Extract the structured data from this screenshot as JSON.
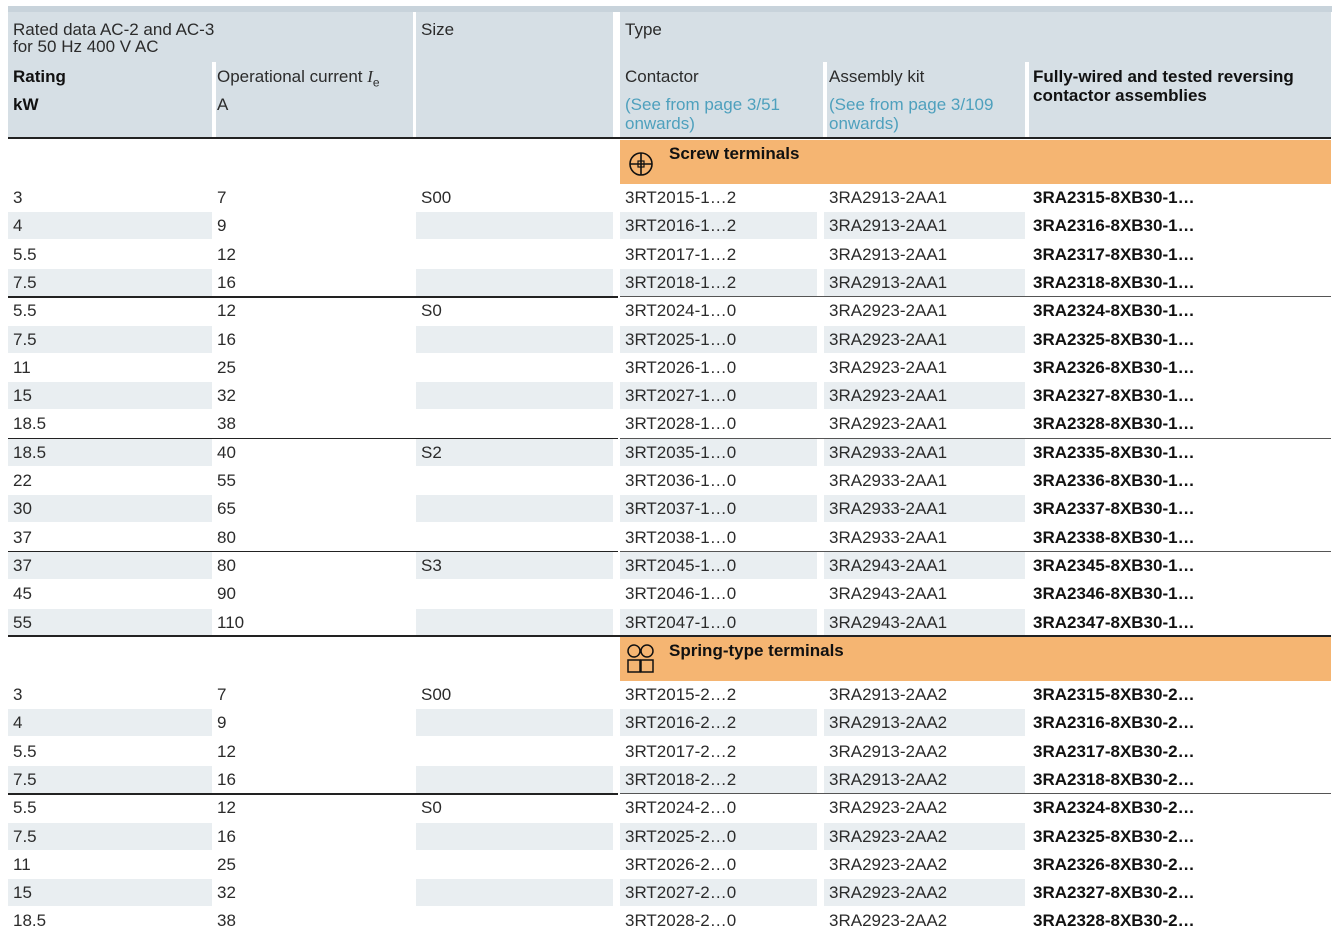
{
  "header": {
    "rated_data_line1": "Rated data AC-2 and AC-3",
    "rated_data_line2": "for 50 Hz 400 V AC",
    "size": "Size",
    "type": "Type",
    "rating": "Rating",
    "rating_unit": "kW",
    "operational_current": "Operational current ",
    "operational_current_symbol": "I",
    "operational_current_sub": "e",
    "operational_current_unit": "A",
    "contactor": "Contactor",
    "contactor_ref_line1": "(See from page 3/51",
    "contactor_ref_line2": "onwards)",
    "assembly_kit": "Assembly kit",
    "assembly_ref_line1": "(See from page 3/109",
    "assembly_ref_line2": "onwards)",
    "assemblies_line1": "Fully-wired and tested reversing",
    "assemblies_line2": "contactor assemblies"
  },
  "sections": [
    {
      "label": "Screw terminals",
      "icon": "screw-terminal-icon",
      "rows": [
        [
          "3",
          "7",
          "S00",
          "3RT2015-1…2",
          "3RA2913-2AA1",
          "3RA2315-8XB30-1…"
        ],
        [
          "4",
          "9",
          "",
          "3RT2016-1…2",
          "3RA2913-2AA1",
          "3RA2316-8XB30-1…"
        ],
        [
          "5.5",
          "12",
          "",
          "3RT2017-1…2",
          "3RA2913-2AA1",
          "3RA2317-8XB30-1…"
        ],
        [
          "7.5",
          "16",
          "",
          "3RT2018-1…2",
          "3RA2913-2AA1",
          "3RA2318-8XB30-1…"
        ],
        [
          "5.5",
          "12",
          "S0",
          "3RT2024-1…0",
          "3RA2923-2AA1",
          "3RA2324-8XB30-1…"
        ],
        [
          "7.5",
          "16",
          "",
          "3RT2025-1…0",
          "3RA2923-2AA1",
          "3RA2325-8XB30-1…"
        ],
        [
          "11",
          "25",
          "",
          "3RT2026-1…0",
          "3RA2923-2AA1",
          "3RA2326-8XB30-1…"
        ],
        [
          "15",
          "32",
          "",
          "3RT2027-1…0",
          "3RA2923-2AA1",
          "3RA2327-8XB30-1…"
        ],
        [
          "18.5",
          "38",
          "",
          "3RT2028-1…0",
          "3RA2923-2AA1",
          "3RA2328-8XB30-1…"
        ],
        [
          "18.5",
          "40",
          "S2",
          "3RT2035-1…0",
          "3RA2933-2AA1",
          "3RA2335-8XB30-1…"
        ],
        [
          "22",
          "55",
          "",
          "3RT2036-1…0",
          "3RA2933-2AA1",
          "3RA2336-8XB30-1…"
        ],
        [
          "30",
          "65",
          "",
          "3RT2037-1…0",
          "3RA2933-2AA1",
          "3RA2337-8XB30-1…"
        ],
        [
          "37",
          "80",
          "",
          "3RT2038-1…0",
          "3RA2933-2AA1",
          "3RA2338-8XB30-1…"
        ],
        [
          "37",
          "80",
          "S3",
          "3RT2045-1…0",
          "3RA2943-2AA1",
          "3RA2345-8XB30-1…"
        ],
        [
          "45",
          "90",
          "",
          "3RT2046-1…0",
          "3RA2943-2AA1",
          "3RA2346-8XB30-1…"
        ],
        [
          "55",
          "110",
          "",
          "3RT2047-1…0",
          "3RA2943-2AA1",
          "3RA2347-8XB30-1…"
        ]
      ]
    },
    {
      "label": "Spring-type terminals",
      "icon": "spring-terminal-icon",
      "rows": [
        [
          "3",
          "7",
          "S00",
          "3RT2015-2…2",
          "3RA2913-2AA2",
          "3RA2315-8XB30-2…"
        ],
        [
          "4",
          "9",
          "",
          "3RT2016-2…2",
          "3RA2913-2AA2",
          "3RA2316-8XB30-2…"
        ],
        [
          "5.5",
          "12",
          "",
          "3RT2017-2…2",
          "3RA2913-2AA2",
          "3RA2317-8XB30-2…"
        ],
        [
          "7.5",
          "16",
          "",
          "3RT2018-2…2",
          "3RA2913-2AA2",
          "3RA2318-8XB30-2…"
        ],
        [
          "5.5",
          "12",
          "S0",
          "3RT2024-2…0",
          "3RA2923-2AA2",
          "3RA2324-8XB30-2…"
        ],
        [
          "7.5",
          "16",
          "",
          "3RT2025-2…0",
          "3RA2923-2AA2",
          "3RA2325-8XB30-2…"
        ],
        [
          "11",
          "25",
          "",
          "3RT2026-2…0",
          "3RA2923-2AA2",
          "3RA2326-8XB30-2…"
        ],
        [
          "15",
          "32",
          "",
          "3RT2027-2…0",
          "3RA2923-2AA2",
          "3RA2327-8XB30-2…"
        ],
        [
          "18.5",
          "38",
          "",
          "3RT2028-2…0",
          "3RA2923-2AA2",
          "3RA2328-8XB30-2…"
        ]
      ]
    }
  ],
  "colors": {
    "header_bg": "#d6dfe5",
    "stripe": "#e9eef1",
    "section_band": "#f5b572",
    "link": "#4ea0bd"
  }
}
